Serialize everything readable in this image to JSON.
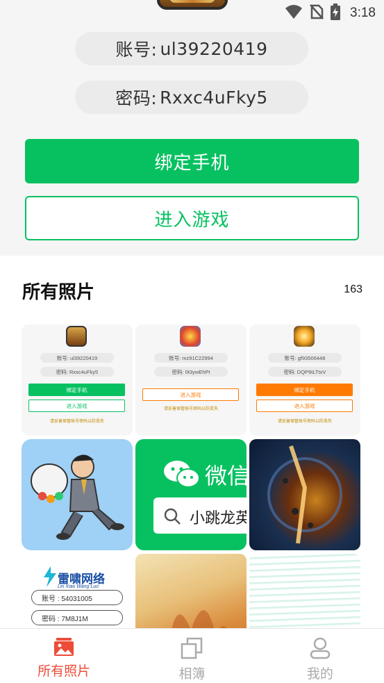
{
  "status_bar": {
    "time": "3:18"
  },
  "account": {
    "label": "账号:",
    "value": "ul39220419"
  },
  "password": {
    "label": "密码:",
    "value": "Rxxc4uFky5"
  },
  "buttons": {
    "bind_phone": "绑定手机",
    "enter_game": "进入游戏"
  },
  "section": {
    "title": "所有照片",
    "count": "163"
  },
  "photos": [
    {
      "type": "screenshot",
      "account": "账号: ul39220419",
      "password": "密码: Rxxc4uFky5",
      "btn1": "绑定手机",
      "btn2": "进入游戏",
      "tip": "请妥善保管账号密码以防丢失"
    },
    {
      "type": "screenshot",
      "account": "账号: mz91C22994",
      "password": "密码: 0t3ywEhPt",
      "btn1": "进入游戏",
      "tip": "请妥善保管账号密码以防丢失"
    },
    {
      "type": "screenshot",
      "account": "账号: gf93506448",
      "password": "密码: DQP9tLTtxV",
      "btn1": "绑定手机",
      "btn2": "进入游戏",
      "tip": "请妥善保管账号密码以防丢失"
    },
    {
      "type": "image",
      "subject": "cartoon-runner"
    },
    {
      "type": "image",
      "title": "微信",
      "search_text": "小跳龙英"
    },
    {
      "type": "image",
      "subject": "planet-explosion"
    },
    {
      "type": "image",
      "brand": "雷啸网络",
      "brand_sub": "Lei Xiao Wang Luo",
      "account": "账号 : 54031005",
      "password": "密码 : 7M8J1M"
    },
    {
      "type": "image",
      "subject": "fire"
    },
    {
      "type": "image",
      "subject": "lines"
    }
  ],
  "nav": [
    {
      "label": "所有照片",
      "icon": "gallery-icon",
      "active": true
    },
    {
      "label": "相簿",
      "icon": "album-icon",
      "active": false
    },
    {
      "label": "我的",
      "icon": "profile-icon",
      "active": false
    }
  ],
  "colors": {
    "accent_green": "#07c160",
    "active_red": "#ee4b38",
    "orange": "#ff7a00"
  }
}
